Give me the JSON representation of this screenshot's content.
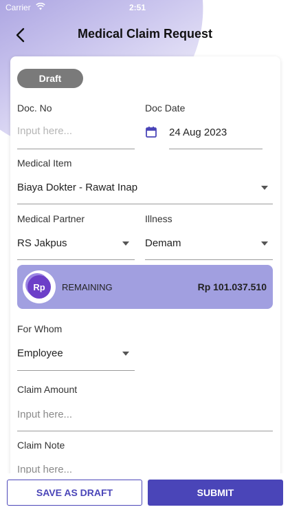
{
  "status_bar": {
    "carrier": "Carrier",
    "time": "2:51"
  },
  "header": {
    "title": "Medical Claim Request",
    "back_icon": "back-arrow-icon"
  },
  "form": {
    "status_badge": "Draft",
    "doc_no": {
      "label": "Doc. No",
      "placeholder": "Input here..."
    },
    "doc_date": {
      "label": "Doc Date",
      "value": "24 Aug 2023",
      "icon": "calendar-icon"
    },
    "medical_item": {
      "label": "Medical Item",
      "value": "Biaya Dokter - Rawat Inap"
    },
    "medical_partner": {
      "label": "Medical Partner",
      "value": "RS Jakpus"
    },
    "illness": {
      "label": "Illness",
      "value": "Demam"
    },
    "remaining": {
      "icon_text": "Rp",
      "label": "REMAINING",
      "amount": "Rp 101.037.510"
    },
    "for_whom": {
      "label": "For Whom",
      "value": "Employee"
    },
    "claim_amount": {
      "label": "Claim Amount",
      "placeholder": "Input here..."
    },
    "claim_note": {
      "label": "Claim Note",
      "placeholder": "Input here..."
    }
  },
  "actions": {
    "save_draft": "SAVE AS DRAFT",
    "submit": "SUBMIT"
  },
  "colors": {
    "primary": "#4a45b8",
    "remaining_bg": "#a19fe0",
    "badge_bg": "#7a7a7a"
  }
}
